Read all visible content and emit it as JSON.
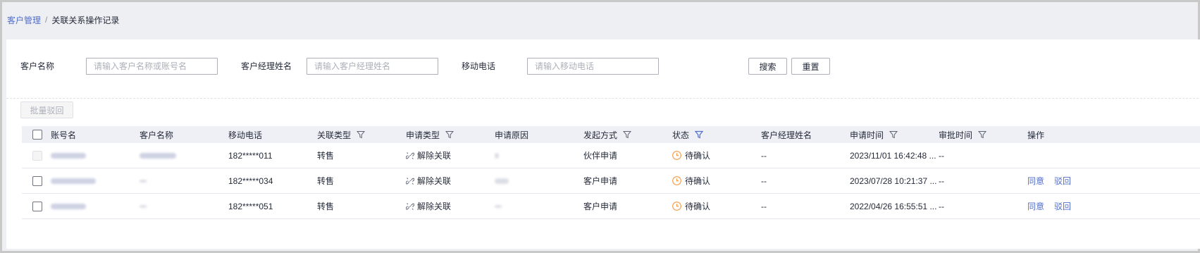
{
  "breadcrumb": {
    "parent": "客户管理",
    "separator": "/",
    "current": "关联关系操作记录"
  },
  "filters": {
    "customer_name": {
      "label": "客户名称",
      "placeholder": "请输入客户名称或账号名"
    },
    "manager_name": {
      "label": "客户经理姓名",
      "placeholder": "请输入客户经理姓名"
    },
    "mobile": {
      "label": "移动电话",
      "placeholder": "请输入移动电话"
    },
    "search_label": "搜索",
    "reset_label": "重置"
  },
  "batch_reject_label": "批量驳回",
  "table": {
    "headers": {
      "account": "账号名",
      "customer": "客户名称",
      "mobile": "移动电话",
      "relation_type": "关联类型",
      "apply_type": "申请类型",
      "apply_reason": "申请原因",
      "initiate_method": "发起方式",
      "status": "状态",
      "manager_name": "客户经理姓名",
      "apply_time": "申请时间",
      "approve_time": "审批时间",
      "actions": "操作"
    },
    "rows": [
      {
        "mobile": "182*****011",
        "relation_type": "转售",
        "apply_type": "解除关联",
        "initiate_method": "伙伴申请",
        "status": "待确认",
        "manager_name": "--",
        "apply_time": "2023/11/01 16:42:48 ...",
        "approve_time": "--"
      },
      {
        "mobile": "182*****034",
        "relation_type": "转售",
        "apply_type": "解除关联",
        "initiate_method": "客户申请",
        "status": "待确认",
        "manager_name": "--",
        "apply_time": "2023/07/28 10:21:37 ...",
        "approve_time": "--",
        "agree_label": "同意",
        "reject_label": "驳回"
      },
      {
        "mobile": "182*****051",
        "relation_type": "转售",
        "apply_type": "解除关联",
        "initiate_method": "客户申请",
        "status": "待确认",
        "manager_name": "--",
        "apply_time": "2022/04/26 16:55:51 ...",
        "approve_time": "--",
        "agree_label": "同意",
        "reject_label": "驳回"
      }
    ]
  },
  "colors": {
    "link": "#526ecc",
    "status_pending": "#fa9841",
    "filter_active": "#526ecc"
  },
  "icons": {
    "filter": "filter-icon",
    "unlink": "unlink-icon",
    "clock": "clock-icon"
  }
}
